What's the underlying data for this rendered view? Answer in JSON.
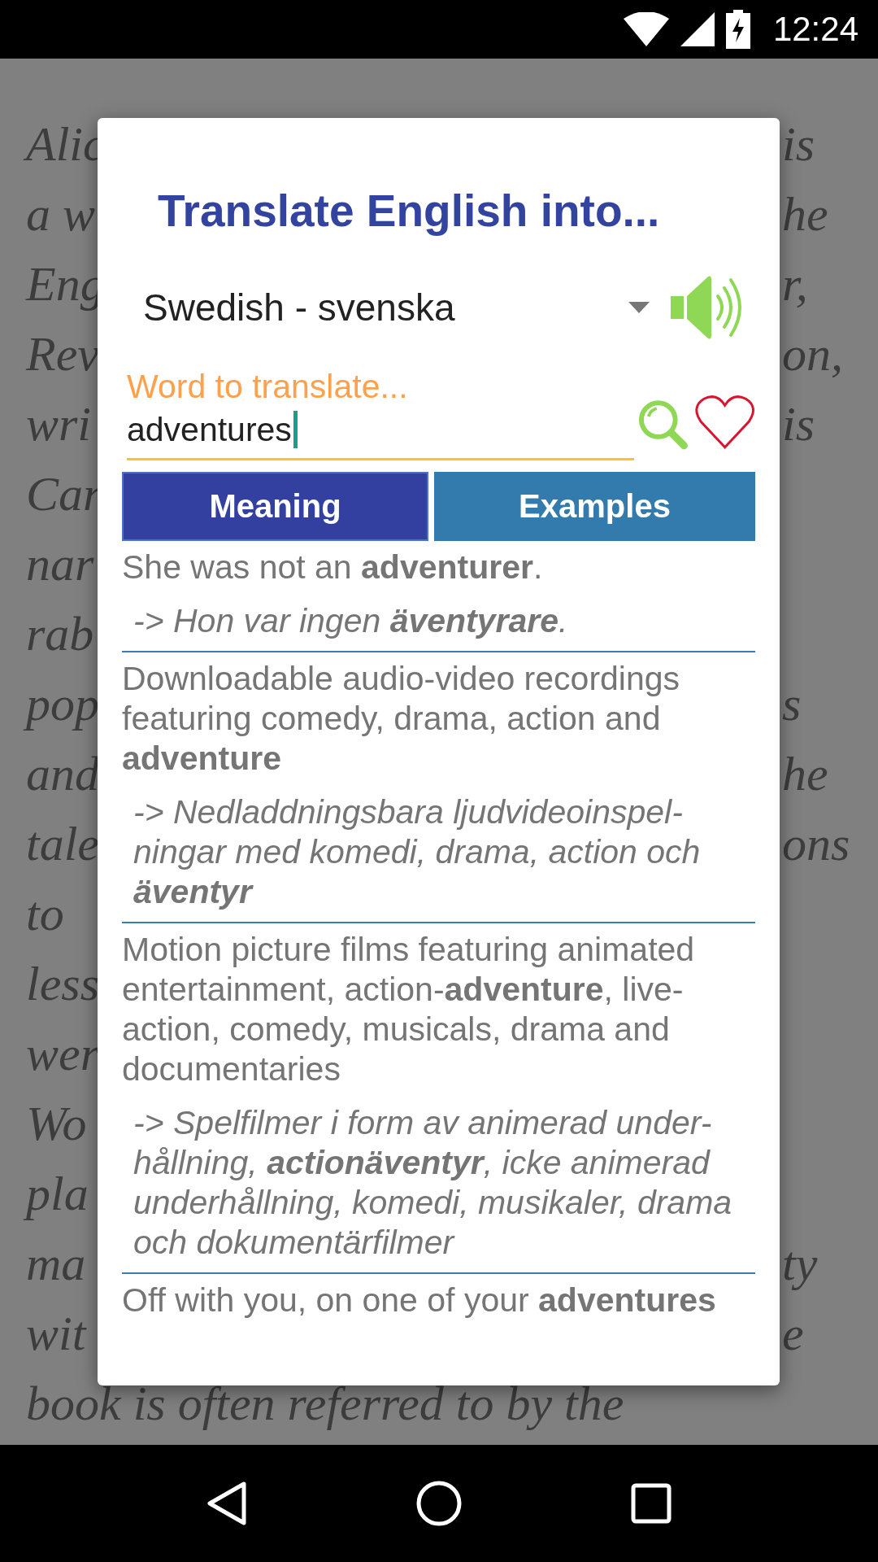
{
  "status_bar": {
    "time": "12:24"
  },
  "background_text": {
    "lines": [
      {
        "left": "Alic",
        "right": "is"
      },
      {
        "left": "a w",
        "right": "he"
      },
      {
        "left": "Eng",
        "right": "r,"
      },
      {
        "left": "Rev",
        "right": "on,"
      },
      {
        "left": "wri",
        "right": "is"
      },
      {
        "left": "Car"
      },
      {
        "left": "nar"
      },
      {
        "left": "rab"
      },
      {
        "left": "pop",
        "right": "s"
      },
      {
        "left": "and",
        "right": "he"
      },
      {
        "left": "tale",
        "right": "ons"
      },
      {
        "left": "to"
      },
      {
        "left": "less"
      },
      {
        "left": "wer"
      },
      {
        "left": "Wo"
      },
      {
        "left": "pla"
      },
      {
        "left": "ma",
        "right": "ty"
      },
      {
        "left": "wit",
        "right": "e"
      },
      {
        "left": "book is often referred to by the"
      }
    ]
  },
  "dialog": {
    "title": "Translate English into...",
    "language": {
      "value": "Swedish - svenska"
    },
    "word_field": {
      "label": "Word to translate...",
      "value": "adventures"
    },
    "tabs": [
      {
        "label": "Meaning",
        "selected": true
      },
      {
        "label": "Examples",
        "selected": false
      }
    ],
    "examples": [
      {
        "source": [
          "She was not an **adventurer**."
        ],
        "translation": [
          "-> Hon var ingen **äventyrare**."
        ]
      },
      {
        "source": [
          "Downloadable audio-video recordings",
          "featuring comedy, drama, action and",
          "**adventure**"
        ],
        "translation": [
          "-> Nedladdningsbara ljudvideoinspel-",
          "ningar med komedi, drama, action och",
          "**äventyr**"
        ]
      },
      {
        "source": [
          "Motion picture films featuring animated",
          "entertainment, action-**adventure**, live-",
          "action, comedy, musicals, drama and",
          "documentaries"
        ],
        "translation": [
          "-> Spelfilmer i form av animerad under-",
          "hållning, **actionäventyr**, icke animerad",
          "underhållning, komedi, musikaler, drama",
          "och dokumentärfilmer"
        ]
      },
      {
        "source": [
          "Off with you, on one of your **adventures**"
        ]
      }
    ]
  }
}
